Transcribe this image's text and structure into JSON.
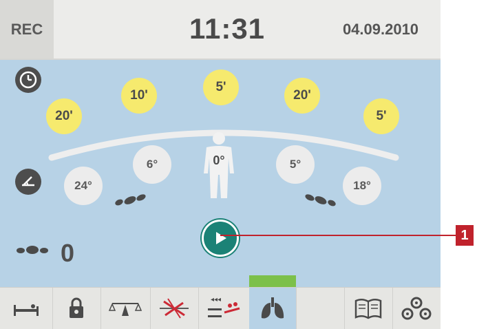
{
  "header": {
    "rec_label": "REC",
    "time": "11:31",
    "date": "04.09.2010"
  },
  "timers": [
    {
      "label": "20'"
    },
    {
      "label": "10'"
    },
    {
      "label": "5'"
    },
    {
      "label": "20'"
    },
    {
      "label": "5'"
    }
  ],
  "angles": [
    {
      "label": "24°"
    },
    {
      "label": "6°"
    },
    {
      "label": "0°"
    },
    {
      "label": "5°"
    },
    {
      "label": "18°"
    }
  ],
  "counter": {
    "value": "0"
  },
  "callout": {
    "number": "1"
  },
  "toolbar": {
    "items": [
      {
        "icon": "bed-icon"
      },
      {
        "icon": "lock-icon"
      },
      {
        "icon": "scale-icon"
      },
      {
        "icon": "position-tilt-icon"
      },
      {
        "icon": "rotation-mode-icon"
      },
      {
        "icon": "lungs-icon",
        "active": true
      },
      {
        "icon": "book-icon"
      },
      {
        "icon": "gears-icon"
      }
    ]
  },
  "colors": {
    "panel": "#b7d2e6",
    "timer": "#f6ea6e",
    "play": "#1b8276",
    "callout": "#c0222c",
    "active_tab": "#7cc04a"
  }
}
